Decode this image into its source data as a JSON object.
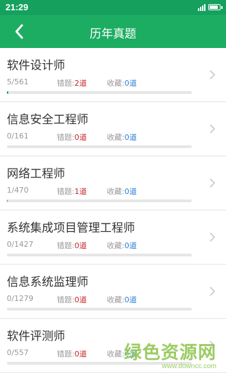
{
  "status_bar": {
    "time": "21:29"
  },
  "header": {
    "title": "历年真题",
    "back_icon": "chevron-left-icon"
  },
  "labels": {
    "wrong": "错题:",
    "fav": "收藏:",
    "unit": "道"
  },
  "items": [
    {
      "title": "软件设计师",
      "progress": "5/561",
      "wrong": "2",
      "fav": "0",
      "fraction": 0.0089
    },
    {
      "title": "信息安全工程师",
      "progress": "0/161",
      "wrong": "0",
      "fav": "0",
      "fraction": 0
    },
    {
      "title": "网络工程师",
      "progress": "1/470",
      "wrong": "1",
      "fav": "0",
      "fraction": 0.0021
    },
    {
      "title": "系统集成项目管理工程师",
      "progress": "0/1427",
      "wrong": "0",
      "fav": "0",
      "fraction": 0
    },
    {
      "title": "信息系统监理师",
      "progress": "0/1279",
      "wrong": "0",
      "fav": "0",
      "fraction": 0
    },
    {
      "title": "软件评测师",
      "progress": "0/557",
      "wrong": "0",
      "fav": "0",
      "fraction": 0
    }
  ],
  "watermark": {
    "main": "绿色资源网",
    "sub": "www.downcc.com"
  },
  "colors": {
    "header": "#1dad62",
    "status": "#16a05e",
    "wrong_value": "#c62828",
    "fav_value": "#2e7fd6"
  }
}
